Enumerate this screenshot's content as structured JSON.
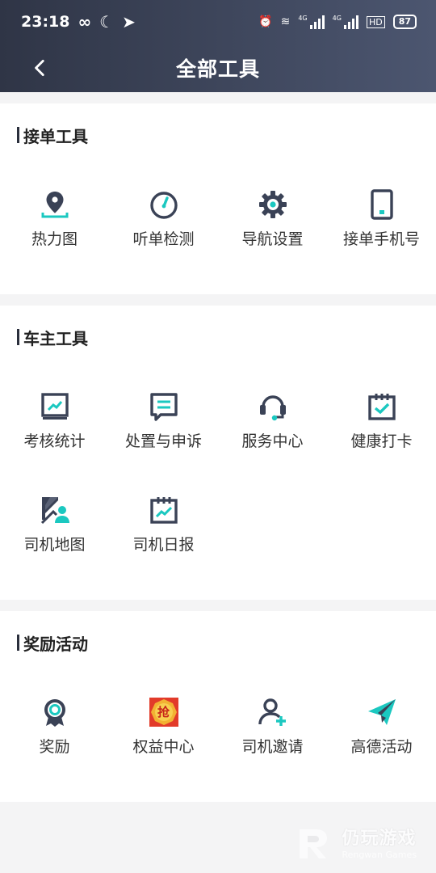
{
  "status_bar": {
    "time": "23:18",
    "battery": "87",
    "network_1": "4G",
    "network_2": "4G"
  },
  "header": {
    "title": "全部工具",
    "back_icon": "chevron-left-icon"
  },
  "sections": [
    {
      "title": "接单工具",
      "items": [
        {
          "label": "热力图",
          "icon": "map-pin-icon"
        },
        {
          "label": "听单检测",
          "icon": "gauge-icon"
        },
        {
          "label": "导航设置",
          "icon": "gear-icon"
        },
        {
          "label": "接单手机号",
          "icon": "phone-icon"
        }
      ]
    },
    {
      "title": "车主工具",
      "items": [
        {
          "label": "考核统计",
          "icon": "stats-chart-icon"
        },
        {
          "label": "处置与申诉",
          "icon": "message-icon"
        },
        {
          "label": "服务中心",
          "icon": "headset-icon"
        },
        {
          "label": "健康打卡",
          "icon": "calendar-check-icon"
        },
        {
          "label": "司机地图",
          "icon": "driver-map-icon"
        },
        {
          "label": "司机日报",
          "icon": "daily-report-icon"
        }
      ]
    },
    {
      "title": "奖励活动",
      "items": [
        {
          "label": "奖励",
          "icon": "medal-icon"
        },
        {
          "label": "权益中心",
          "icon": "grab-badge-icon",
          "badge_text": "抢"
        },
        {
          "label": "司机邀请",
          "icon": "add-user-icon"
        },
        {
          "label": "高德活动",
          "icon": "paper-plane-icon"
        }
      ]
    }
  ],
  "watermark": {
    "cn": "仍玩游戏",
    "en": "Rengwan Games"
  },
  "colors": {
    "header_start": "#2f3546",
    "header_end": "#4c5670",
    "icon_dark": "#3a4256",
    "accent": "#1bc8c0",
    "background": "#f4f4f5"
  }
}
